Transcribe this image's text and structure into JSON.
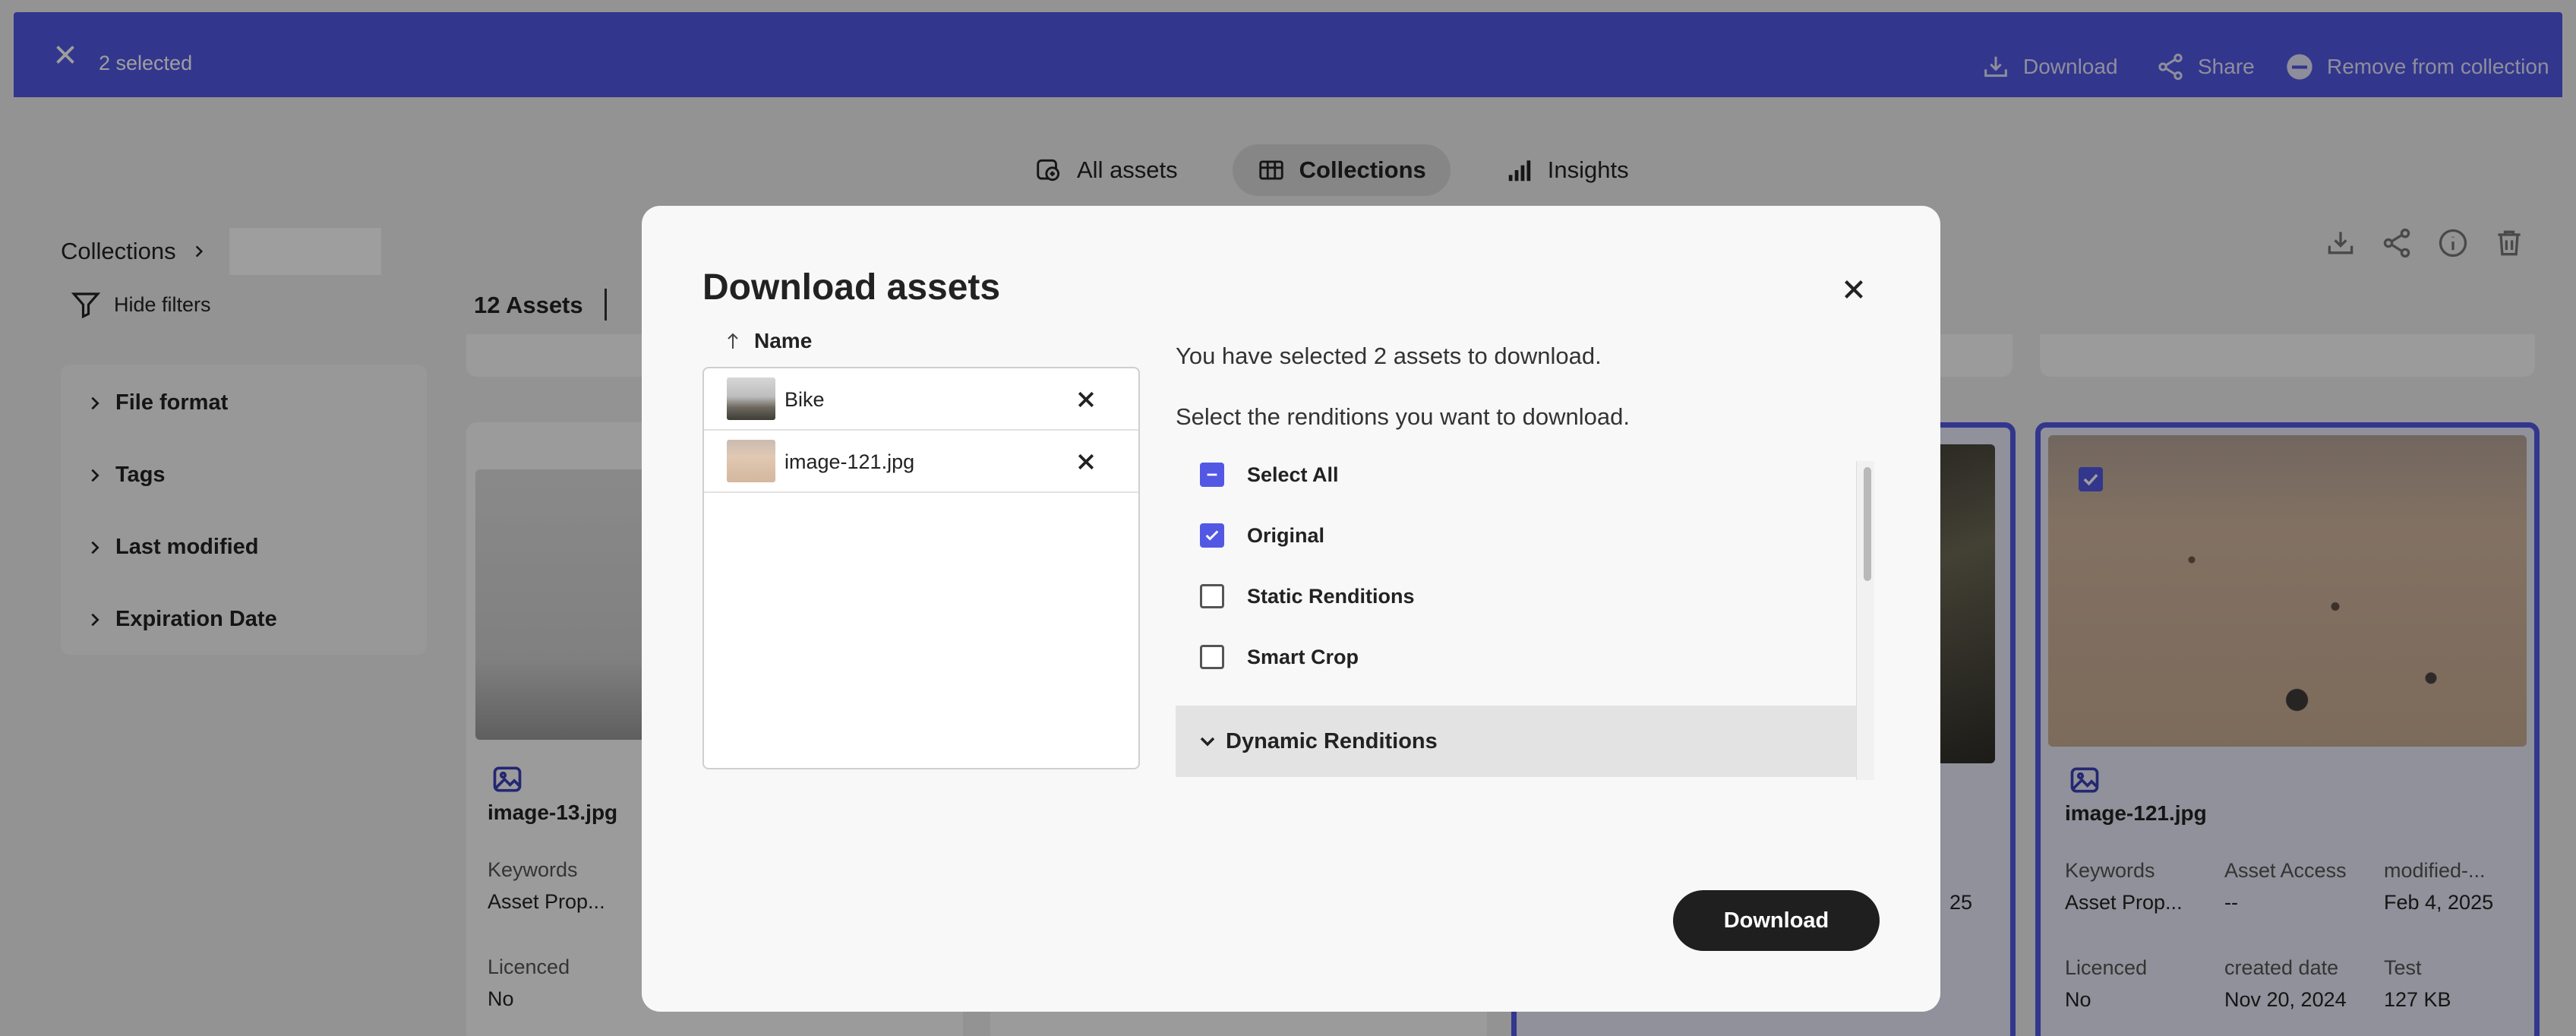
{
  "selection_bar": {
    "count_label": "2 selected",
    "actions": {
      "download": "Download",
      "share": "Share",
      "remove": "Remove from collection"
    }
  },
  "tabs": [
    {
      "label": "All assets",
      "icon": "all-assets-icon"
    },
    {
      "label": "Collections",
      "icon": "grid-icon",
      "active": true
    },
    {
      "label": "Insights",
      "icon": "chart-icon"
    }
  ],
  "breadcrumb": {
    "root": "Collections"
  },
  "filters": {
    "hide_label": "Hide filters",
    "items": [
      "File format",
      "Tags",
      "Last modified",
      "Expiration Date"
    ]
  },
  "assets_count": "12 Assets",
  "cards": [
    {
      "name": "image-13.jpg",
      "keywords_label": "Keywords",
      "keywords_value": "Asset Prop...",
      "licenced_label": "Licenced",
      "licenced_value": "No"
    },
    {
      "partial_value": "25"
    },
    {
      "name": "image-121.jpg",
      "keywords_label": "Keywords",
      "keywords_value": "Asset Prop...",
      "access_label": "Asset Access",
      "access_value": "--",
      "modified_label": "modified-...",
      "modified_value": "Feb 4, 2025",
      "licenced_label": "Licenced",
      "licenced_value": "No",
      "created_label": "created date",
      "created_value": "Nov 20, 2024",
      "test_label": "Test",
      "test_value": "127 KB"
    }
  ],
  "modal": {
    "title": "Download assets",
    "name_header": "Name",
    "files": [
      {
        "name": "Bike"
      },
      {
        "name": "image-121.jpg"
      }
    ],
    "info_selected": "You have selected 2 assets to download.",
    "info_select": "Select the renditions you want to download.",
    "renditions": [
      {
        "label": "Select All",
        "state": "indeterminate"
      },
      {
        "label": "Original",
        "state": "checked"
      },
      {
        "label": "Static Renditions",
        "state": "unchecked"
      },
      {
        "label": "Smart Crop",
        "state": "unchecked"
      }
    ],
    "dynamic_label": "Dynamic Renditions",
    "download_button": "Download"
  },
  "colors": {
    "accent": "#5258e4",
    "primary_button": "#1f1f1f"
  }
}
